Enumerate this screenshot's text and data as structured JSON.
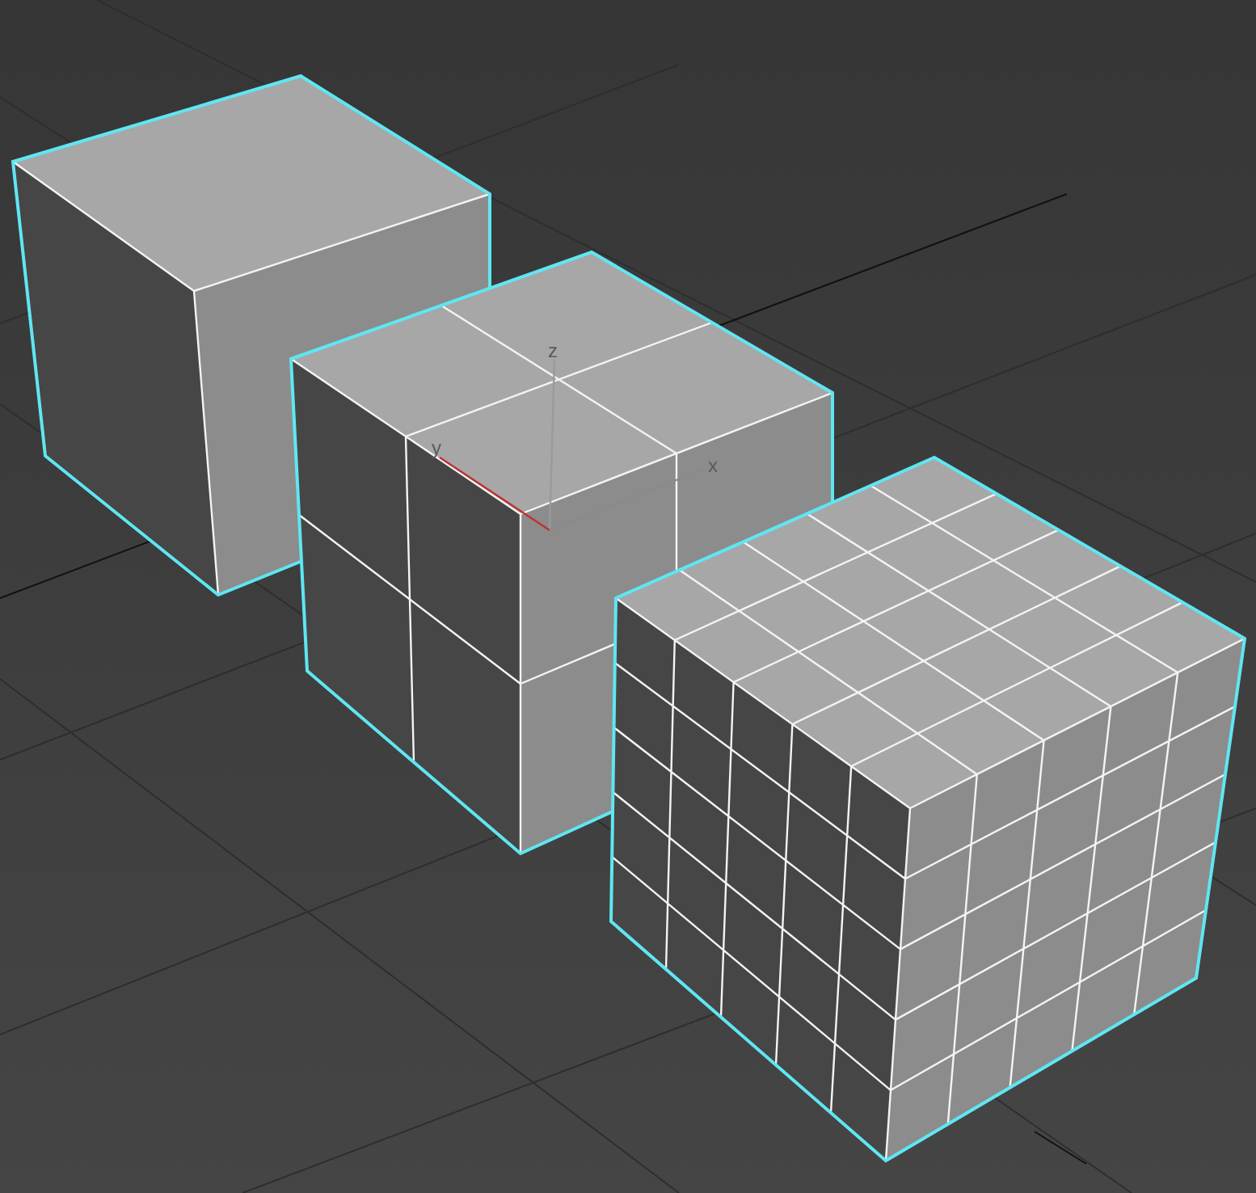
{
  "viewport": {
    "objects": [
      {
        "kind": "box1",
        "selected": true
      },
      {
        "kind": "box2",
        "selected": true
      },
      {
        "kind": "box5",
        "selected": true
      }
    ],
    "gizmo": {
      "axes": [
        {
          "kind": "z",
          "label": "z"
        },
        {
          "kind": "y",
          "label": "y"
        },
        {
          "kind": "x",
          "label": "x"
        }
      ]
    }
  }
}
